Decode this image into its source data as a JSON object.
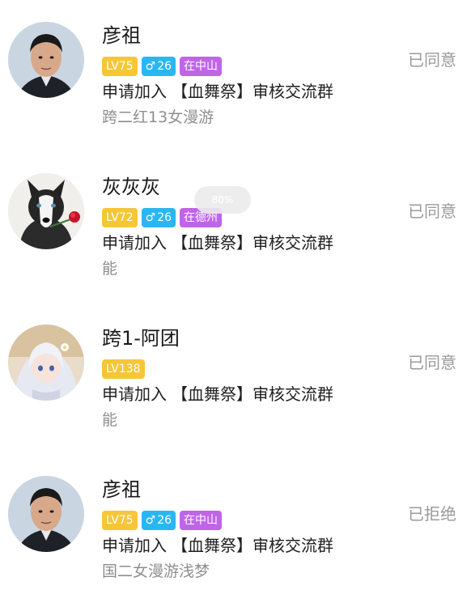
{
  "overlay": {
    "zoom_text": "80%"
  },
  "requests": [
    {
      "name": "彦祖",
      "avatar_icon": "man-portrait-avatar",
      "level": "LV75",
      "gender_icon": "♂",
      "age": "26",
      "location": "在中山",
      "request_prefix": "申请加入",
      "group_name": "【血舞祭】审核交流群",
      "note": "跨二红13女漫游",
      "status": "已同意"
    },
    {
      "name": "灰灰灰",
      "avatar_icon": "husky-rose-avatar",
      "level": "LV72",
      "gender_icon": "♂",
      "age": "26",
      "location": "在德州",
      "request_prefix": "申请加入",
      "group_name": "【血舞祭】审核交流群",
      "note": "能",
      "status": "已同意"
    },
    {
      "name": "跨1-阿团",
      "avatar_icon": "anime-girl-avatar",
      "level": "LV138",
      "request_prefix": "申请加入",
      "group_name": "【血舞祭】审核交流群",
      "note": "能",
      "status": "已同意"
    },
    {
      "name": "彦祖",
      "avatar_icon": "man-portrait-avatar",
      "level": "LV75",
      "gender_icon": "♂",
      "age": "26",
      "location": "在中山",
      "request_prefix": "申请加入",
      "group_name": "【血舞祭】审核交流群",
      "note": "国二女漫游浅梦",
      "status": "已拒绝"
    }
  ]
}
